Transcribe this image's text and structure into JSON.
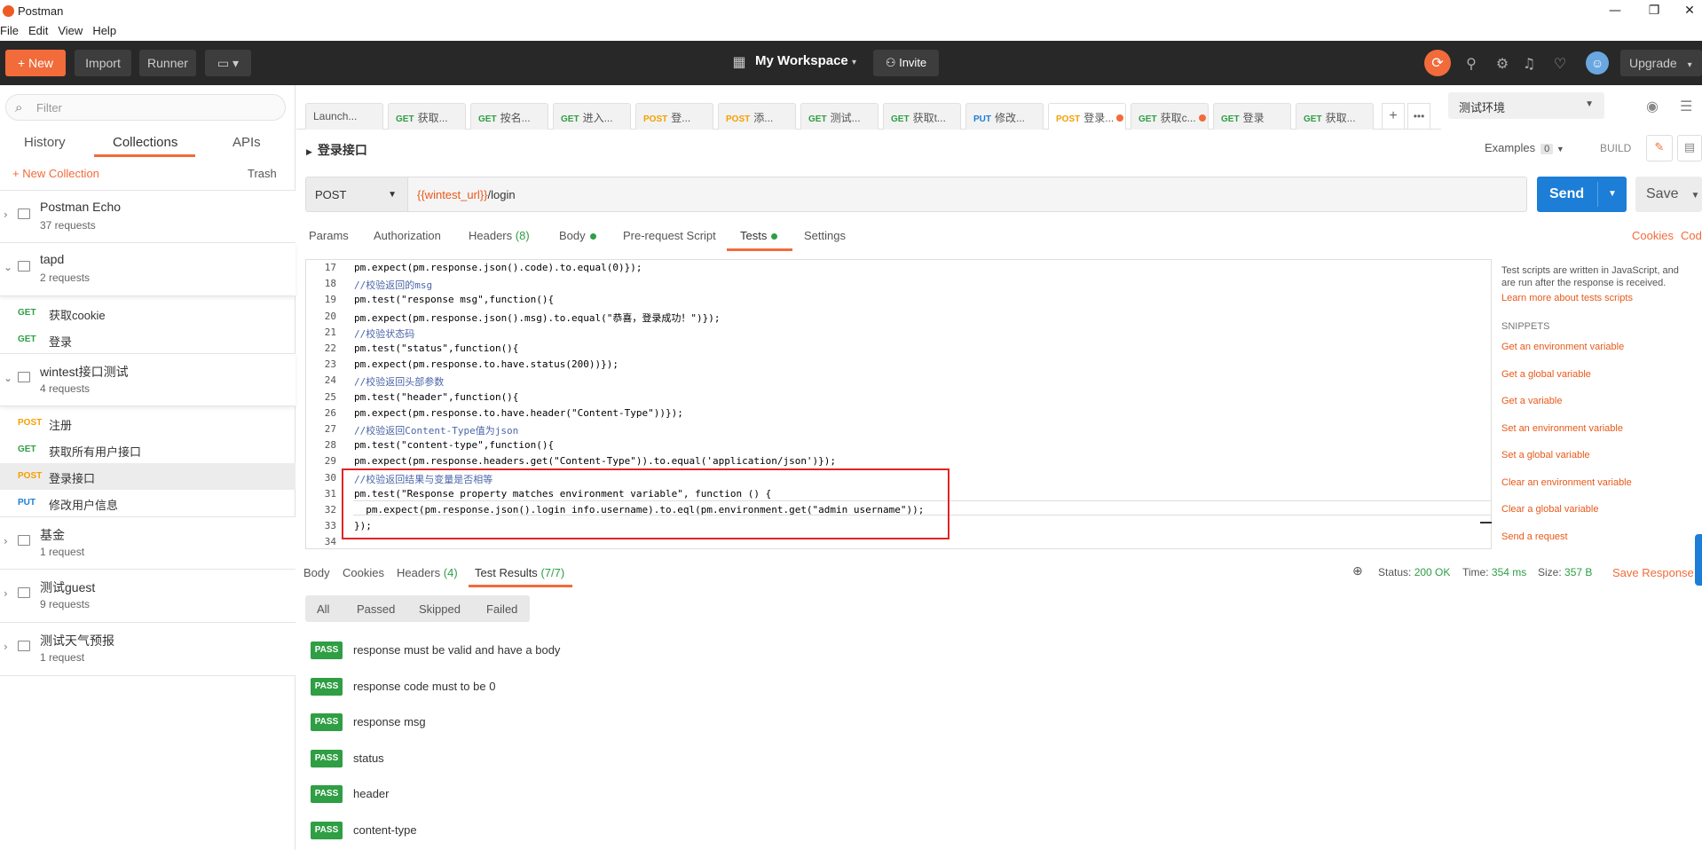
{
  "window": {
    "title": "Postman",
    "min": "—",
    "max": "❐",
    "close": "✕"
  },
  "menu": [
    "File",
    "Edit",
    "View",
    "Help"
  ],
  "toolbar": {
    "new_label": "+ New",
    "import_label": "Import",
    "runner_label": "Runner",
    "workspace_label": "My Workspace",
    "invite_label": "Invite",
    "upgrade_label": "Upgrade"
  },
  "sidebar": {
    "filter_placeholder": "Filter",
    "tabs": [
      "History",
      "Collections",
      "APIs"
    ],
    "new_collection": "+ New Collection",
    "trash": "Trash",
    "collections": [
      {
        "name": "Postman Echo",
        "count": "37 requests"
      },
      {
        "name": "tapd",
        "count": "2 requests",
        "requests": [
          {
            "method": "GET",
            "name": "获取cookie"
          },
          {
            "method": "GET",
            "name": "登录"
          }
        ]
      },
      {
        "name": "wintest接口测试",
        "count": "4 requests",
        "requests": [
          {
            "method": "POST",
            "name": "注册"
          },
          {
            "method": "GET",
            "name": "获取所有用户接口"
          },
          {
            "method": "POST",
            "name": "登录接口"
          },
          {
            "method": "PUT",
            "name": "修改用户信息"
          }
        ]
      },
      {
        "name": "基金",
        "count": "1 request"
      },
      {
        "name": "测试guest",
        "count": "9 requests"
      },
      {
        "name": "测试天气预报",
        "count": "1 request"
      }
    ]
  },
  "tabs": [
    {
      "method": "",
      "label": "Launch..."
    },
    {
      "method": "GET",
      "label": "获取..."
    },
    {
      "method": "GET",
      "label": "按名..."
    },
    {
      "method": "GET",
      "label": "进入..."
    },
    {
      "method": "POST",
      "label": "登..."
    },
    {
      "method": "POST",
      "label": "添..."
    },
    {
      "method": "GET",
      "label": "测试..."
    },
    {
      "method": "GET",
      "label": "获取t..."
    },
    {
      "method": "PUT",
      "label": "修改..."
    },
    {
      "method": "POST",
      "label": "登录..."
    },
    {
      "method": "GET",
      "label": "获取c..."
    },
    {
      "method": "GET",
      "label": "登录"
    },
    {
      "method": "GET",
      "label": "获取..."
    }
  ],
  "environment": "测试环境",
  "request": {
    "name": "登录接口",
    "examples_label": "Examples",
    "examples_count": "0",
    "build_label": "BUILD",
    "method": "POST",
    "url_var": "{{wintest_url}}",
    "url_path": "/login",
    "send_label": "Send",
    "save_label": "Save",
    "tabs": {
      "params": "Params",
      "auth": "Authorization",
      "headers": "Headers",
      "headers_count": "(8)",
      "body": "Body",
      "prerequest": "Pre-request Script",
      "tests": "Tests",
      "settings": "Settings"
    },
    "cookies_label": "Cookies",
    "code_label": "Cod"
  },
  "code_lines": [
    {
      "n": "17",
      "t": "pm.expect(pm.response.json().code).to.equal(0)});"
    },
    {
      "n": "18",
      "t": "//校验返回的msg"
    },
    {
      "n": "19",
      "t": "pm.test(\"response msg\",function(){"
    },
    {
      "n": "20",
      "t": "pm.expect(pm.response.json().msg).to.equal(\"恭喜，登录成功！\")});"
    },
    {
      "n": "21",
      "t": "//校验状态码"
    },
    {
      "n": "22",
      "t": "pm.test(\"status\",function(){"
    },
    {
      "n": "23",
      "t": "pm.expect(pm.response.to.have.status(200))});"
    },
    {
      "n": "24",
      "t": "//校验返回头部参数"
    },
    {
      "n": "25",
      "t": "pm.test(\"header\",function(){"
    },
    {
      "n": "26",
      "t": "pm.expect(pm.response.to.have.header(\"Content-Type\"))});"
    },
    {
      "n": "27",
      "t": "//校验返回Content-Type值为json"
    },
    {
      "n": "28",
      "t": "pm.test(\"content-type\",function(){"
    },
    {
      "n": "29",
      "t": "pm.expect(pm.response.headers.get(\"Content-Type\")).to.equal('application/json')});"
    },
    {
      "n": "30",
      "t": "//校验返回结果与变量是否相等"
    },
    {
      "n": "31",
      "t": "pm.test(\"Response property matches environment variable\", function () {"
    },
    {
      "n": "32",
      "t": "  pm.expect(pm.response.json().login_info.username).to.eql(pm.environment.get(\"admin_username\"));"
    },
    {
      "n": "33",
      "t": "});"
    },
    {
      "n": "34",
      "t": ""
    }
  ],
  "right_panel": {
    "description": "Test scripts are written in JavaScript, and are run after the response is received.",
    "learn_more": "Learn more about tests scripts",
    "snippets_title": "SNIPPETS",
    "snippets": [
      "Get an environment variable",
      "Get a global variable",
      "Get a variable",
      "Set an environment variable",
      "Set a global variable",
      "Clear an environment variable",
      "Clear a global variable",
      "Send a request"
    ]
  },
  "response": {
    "tabs": {
      "body": "Body",
      "cookies": "Cookies",
      "headers": "Headers",
      "headers_count": "(4)",
      "test_results": "Test Results",
      "test_results_count": "(7/7)"
    },
    "status_label": "Status:",
    "status_value": "200 OK",
    "time_label": "Time:",
    "time_value": "354 ms",
    "size_label": "Size:",
    "size_value": "357 B",
    "save_response": "Save Response",
    "filters": [
      "All",
      "Passed",
      "Skipped",
      "Failed"
    ],
    "results": [
      {
        "badge": "PASS",
        "text": "response must be valid and have a body"
      },
      {
        "badge": "PASS",
        "text": "response code must to be 0"
      },
      {
        "badge": "PASS",
        "text": "response msg"
      },
      {
        "badge": "PASS",
        "text": "status"
      },
      {
        "badge": "PASS",
        "text": "header"
      },
      {
        "badge": "PASS",
        "text": "content-type"
      }
    ]
  }
}
